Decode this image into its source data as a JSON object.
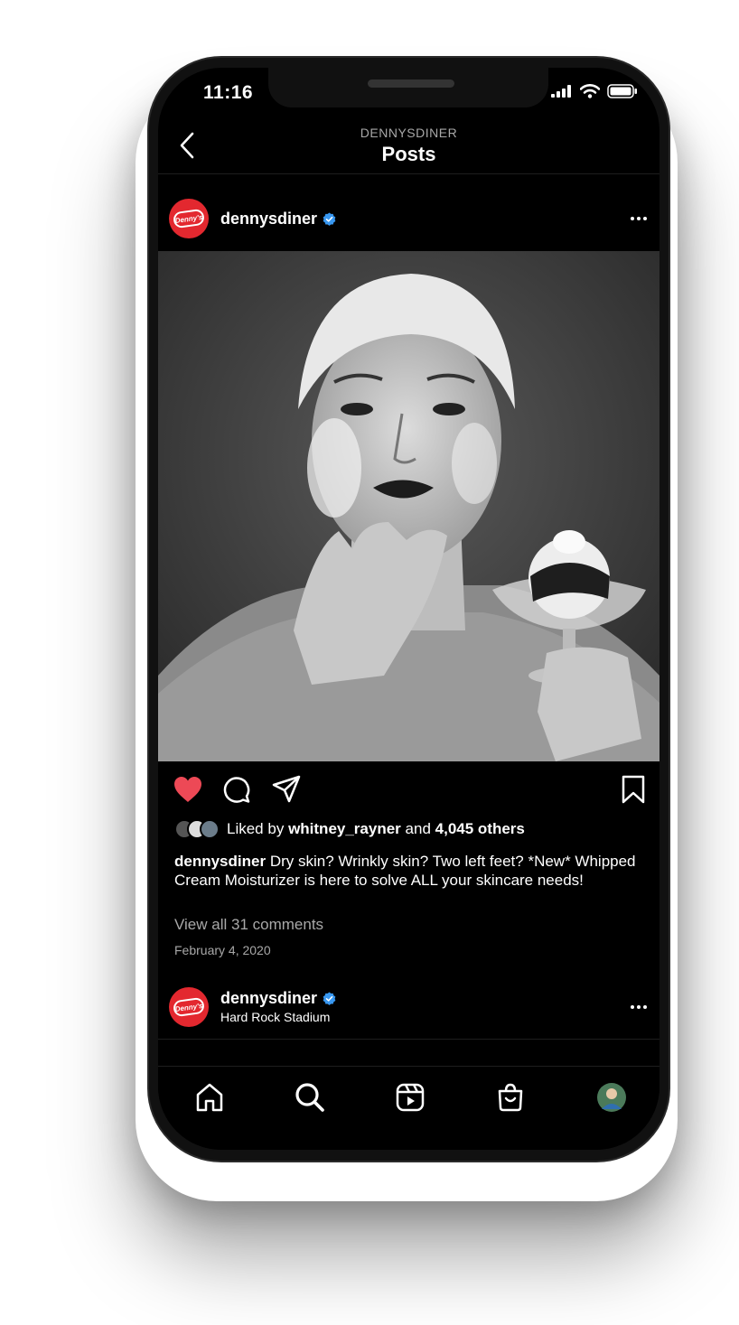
{
  "status_bar": {
    "time": "11:16"
  },
  "header": {
    "account": "DENNYSDINER",
    "title": "Posts"
  },
  "post": {
    "username": "dennysdiner",
    "avatar_text": "Denny's",
    "liked": true,
    "liked_by_prefix": "Liked by",
    "liked_by_user": "whitney_rayner",
    "liked_by_and": "and",
    "liked_by_others": "4,045 others",
    "caption_user": "dennysdiner",
    "caption_text": " Dry skin? Wrinkly skin? Two left feet? *New* Whipped Cream Moisturizer is here to solve ALL your skincare needs!",
    "comments_link": "View all 31 comments",
    "date": "February 4, 2020"
  },
  "next_post": {
    "username": "dennysdiner",
    "avatar_text": "Denny's",
    "location": "Hard Rock Stadium"
  },
  "colors": {
    "like": "#ed4956",
    "verified": "#3897f0",
    "brand": "#e3282f"
  },
  "tabbar": {
    "icons": [
      "home-icon",
      "search-icon",
      "reels-icon",
      "shop-icon",
      "profile-avatar"
    ]
  }
}
